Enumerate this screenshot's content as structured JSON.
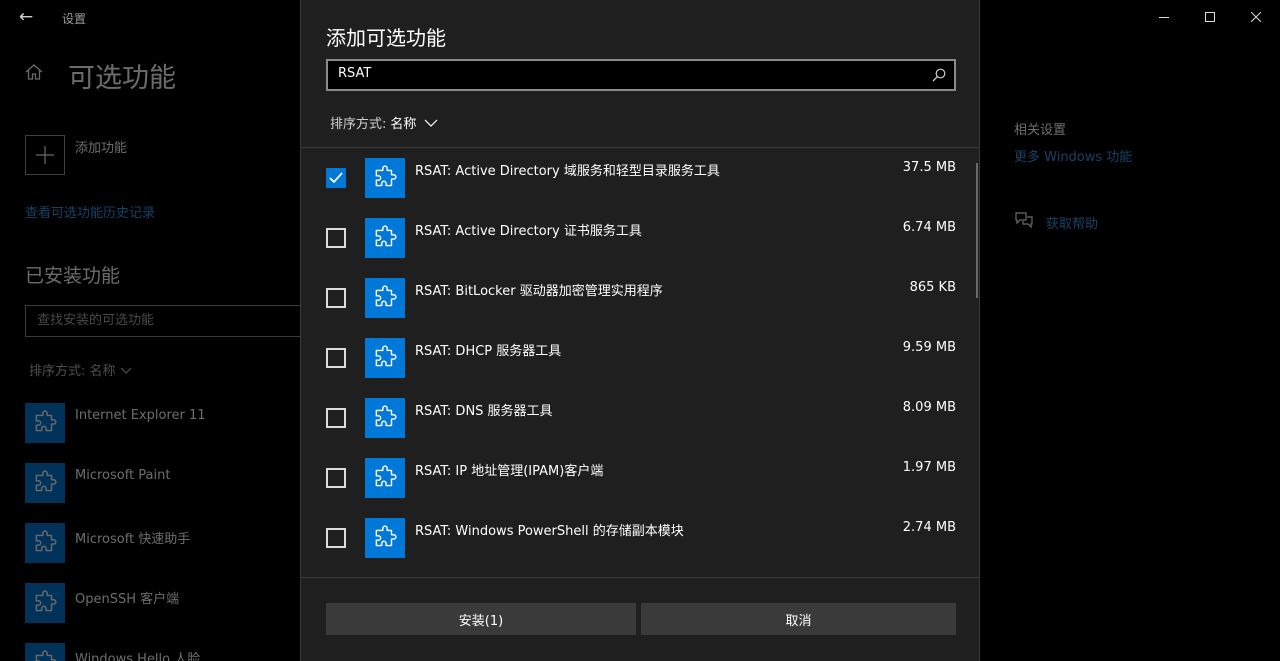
{
  "window": {
    "app_title": "设置",
    "back_icon": "←"
  },
  "page": {
    "title": "可选功能",
    "add_feature": "添加功能",
    "history_link": "查看可选功能历史记录",
    "installed_heading": "已安装功能",
    "installed_search_placeholder": "查找安装的可选功能",
    "sort_label": "排序方式:",
    "sort_value": "名称",
    "installed_items": [
      {
        "label": "Internet Explorer 11"
      },
      {
        "label": "Microsoft Paint"
      },
      {
        "label": "Microsoft 快速助手"
      },
      {
        "label": "OpenSSH 客户端"
      },
      {
        "label": "Windows Hello 人脸"
      }
    ]
  },
  "related": {
    "heading": "相关设置",
    "link": "更多 Windows 功能",
    "help": "获取帮助"
  },
  "dialog": {
    "title": "添加可选功能",
    "search_value": "RSAT",
    "sort_label": "排序方式:",
    "sort_value": "名称",
    "features": [
      {
        "name": "RSAT: Active Directory 域服务和轻型目录服务工具",
        "size": "37.5 MB",
        "checked": true
      },
      {
        "name": "RSAT: Active Directory 证书服务工具",
        "size": "6.74 MB",
        "checked": false
      },
      {
        "name": "RSAT: BitLocker 驱动器加密管理实用程序",
        "size": "865 KB",
        "checked": false
      },
      {
        "name": "RSAT: DHCP 服务器工具",
        "size": "9.59 MB",
        "checked": false
      },
      {
        "name": "RSAT: DNS 服务器工具",
        "size": "8.09 MB",
        "checked": false
      },
      {
        "name": "RSAT: IP 地址管理(IPAM)客户端",
        "size": "1.97 MB",
        "checked": false
      },
      {
        "name": "RSAT: Windows PowerShell 的存储副本模块",
        "size": "2.74 MB",
        "checked": false
      }
    ],
    "install_button": "安装(1)",
    "cancel_button": "取消"
  },
  "colors": {
    "accent": "#0078d7",
    "link": "#3b9cf0",
    "dialog_bg": "#1f1f1f",
    "button_bg": "#3a3a3a"
  }
}
